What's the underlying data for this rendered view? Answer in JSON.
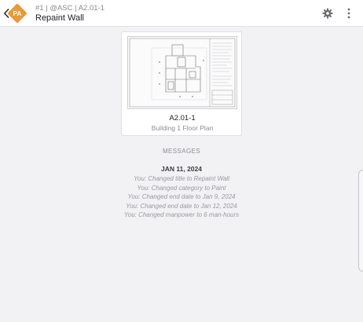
{
  "header": {
    "subtitle": "#1 | @ASC | A2.01-1",
    "title": "Repaint Wall",
    "badge_initials": "PA",
    "badge_color": "#e79a3c",
    "icons": [
      "chevron-left-icon",
      "gear-icon",
      "more-vertical-icon"
    ]
  },
  "attachment": {
    "sheet_number": "A2.01-1",
    "sheet_name": "Building 1 Floor Plan"
  },
  "messages": {
    "heading": "MESSAGES",
    "groups": [
      {
        "date": "JAN 11, 2024",
        "entries": [
          "You: Changed title to Repaint Wall",
          "You: Changed category to Paint",
          "You: Changed end date to Jan 9, 2024",
          "You: Changed end date to Jan 12, 2024",
          "You: Changed manpower to 6 man-hours"
        ]
      }
    ]
  }
}
